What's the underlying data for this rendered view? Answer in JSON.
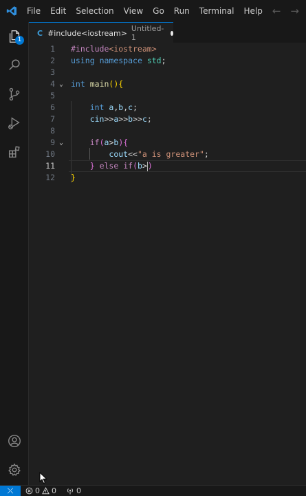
{
  "titlebar": {
    "menu": [
      "File",
      "Edit",
      "Selection",
      "View",
      "Go",
      "Run",
      "Terminal",
      "Help"
    ],
    "back_glyph": "←",
    "forward_glyph": "→"
  },
  "activitybar": {
    "items": [
      {
        "name": "explorer-icon",
        "badge": "1"
      },
      {
        "name": "search-icon"
      },
      {
        "name": "source-control-icon"
      },
      {
        "name": "run-debug-icon"
      },
      {
        "name": "extensions-icon"
      }
    ],
    "bottom": [
      {
        "name": "accounts-icon"
      },
      {
        "name": "manage-gear-icon"
      }
    ]
  },
  "tab": {
    "icon_glyph": "C",
    "label": "#include<iostream>",
    "description": "Untitled-1",
    "dirty": true
  },
  "editor": {
    "current_line": 11,
    "lines": [
      {
        "n": "1",
        "fold": "",
        "tokens": [
          [
            "c-dir",
            "#include"
          ],
          [
            "c-inc",
            "<iostream>"
          ]
        ]
      },
      {
        "n": "2",
        "fold": "",
        "tokens": [
          [
            "c-kw",
            "using"
          ],
          [
            "c-txt",
            " "
          ],
          [
            "c-kw",
            "namespace"
          ],
          [
            "c-txt",
            " "
          ],
          [
            "c-ns",
            "std"
          ],
          [
            "c-txt",
            ";"
          ]
        ]
      },
      {
        "n": "3",
        "fold": "",
        "tokens": []
      },
      {
        "n": "4",
        "fold": "⌄",
        "tokens": [
          [
            "c-kw",
            "int"
          ],
          [
            "c-txt",
            " "
          ],
          [
            "c-fn",
            "main"
          ],
          [
            "c-br1",
            "()"
          ],
          [
            "c-br1",
            "{"
          ]
        ]
      },
      {
        "n": "5",
        "fold": "",
        "tokens": []
      },
      {
        "n": "6",
        "fold": "",
        "tokens": [
          [
            "c-txt",
            "    "
          ],
          [
            "c-kw",
            "int"
          ],
          [
            "c-txt",
            " "
          ],
          [
            "c-var",
            "a"
          ],
          [
            "c-txt",
            ","
          ],
          [
            "c-var",
            "b"
          ],
          [
            "c-txt",
            ","
          ],
          [
            "c-var",
            "c"
          ],
          [
            "c-txt",
            ";"
          ]
        ]
      },
      {
        "n": "7",
        "fold": "",
        "tokens": [
          [
            "c-txt",
            "    "
          ],
          [
            "c-var",
            "cin"
          ],
          [
            "c-txt",
            ">>"
          ],
          [
            "c-var",
            "a"
          ],
          [
            "c-txt",
            ">>"
          ],
          [
            "c-var",
            "b"
          ],
          [
            "c-txt",
            ">>"
          ],
          [
            "c-var",
            "c"
          ],
          [
            "c-txt",
            ";"
          ]
        ]
      },
      {
        "n": "8",
        "fold": "",
        "tokens": []
      },
      {
        "n": "9",
        "fold": "⌄",
        "tokens": [
          [
            "c-txt",
            "    "
          ],
          [
            "c-ctl",
            "if"
          ],
          [
            "c-br2",
            "("
          ],
          [
            "c-var",
            "a"
          ],
          [
            "c-txt",
            ">"
          ],
          [
            "c-var",
            "b"
          ],
          [
            "c-br2",
            ")"
          ],
          [
            "c-br2",
            "{"
          ]
        ]
      },
      {
        "n": "10",
        "fold": "",
        "tokens": [
          [
            "c-txt",
            "        "
          ],
          [
            "c-var",
            "cout"
          ],
          [
            "c-txt",
            "<<"
          ],
          [
            "c-str",
            "\"a is greater\""
          ],
          [
            "c-txt",
            ";"
          ]
        ]
      },
      {
        "n": "11",
        "fold": "",
        "tokens": [
          [
            "c-txt",
            "    "
          ],
          [
            "c-br2",
            "}"
          ],
          [
            "c-txt",
            " "
          ],
          [
            "c-ctl",
            "else"
          ],
          [
            "c-txt",
            " "
          ],
          [
            "c-ctl",
            "if"
          ],
          [
            "c-br2",
            "("
          ],
          [
            "c-var",
            "b"
          ],
          [
            "c-txt",
            ">"
          ],
          [
            "cursor",
            ""
          ],
          [
            "c-br2",
            ")"
          ]
        ]
      },
      {
        "n": "12",
        "fold": "",
        "tokens": [
          [
            "c-br1",
            "}"
          ]
        ]
      }
    ]
  },
  "statusbar": {
    "remote_glyph": "⤫",
    "errors": "0",
    "warnings": "0",
    "ports": "0"
  }
}
